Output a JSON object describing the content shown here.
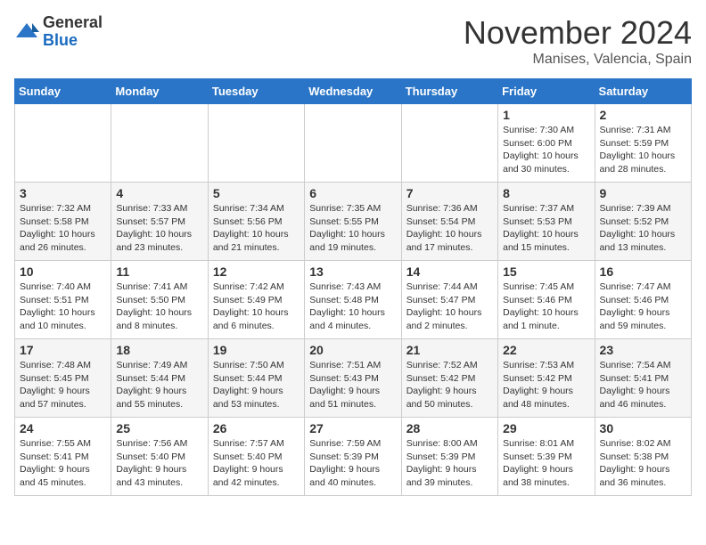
{
  "header": {
    "logo_general": "General",
    "logo_blue": "Blue",
    "month_title": "November 2024",
    "location": "Manises, Valencia, Spain"
  },
  "weekdays": [
    "Sunday",
    "Monday",
    "Tuesday",
    "Wednesday",
    "Thursday",
    "Friday",
    "Saturday"
  ],
  "weeks": [
    [
      {
        "day": "",
        "info": ""
      },
      {
        "day": "",
        "info": ""
      },
      {
        "day": "",
        "info": ""
      },
      {
        "day": "",
        "info": ""
      },
      {
        "day": "",
        "info": ""
      },
      {
        "day": "1",
        "info": "Sunrise: 7:30 AM\nSunset: 6:00 PM\nDaylight: 10 hours and 30 minutes."
      },
      {
        "day": "2",
        "info": "Sunrise: 7:31 AM\nSunset: 5:59 PM\nDaylight: 10 hours and 28 minutes."
      }
    ],
    [
      {
        "day": "3",
        "info": "Sunrise: 7:32 AM\nSunset: 5:58 PM\nDaylight: 10 hours and 26 minutes."
      },
      {
        "day": "4",
        "info": "Sunrise: 7:33 AM\nSunset: 5:57 PM\nDaylight: 10 hours and 23 minutes."
      },
      {
        "day": "5",
        "info": "Sunrise: 7:34 AM\nSunset: 5:56 PM\nDaylight: 10 hours and 21 minutes."
      },
      {
        "day": "6",
        "info": "Sunrise: 7:35 AM\nSunset: 5:55 PM\nDaylight: 10 hours and 19 minutes."
      },
      {
        "day": "7",
        "info": "Sunrise: 7:36 AM\nSunset: 5:54 PM\nDaylight: 10 hours and 17 minutes."
      },
      {
        "day": "8",
        "info": "Sunrise: 7:37 AM\nSunset: 5:53 PM\nDaylight: 10 hours and 15 minutes."
      },
      {
        "day": "9",
        "info": "Sunrise: 7:39 AM\nSunset: 5:52 PM\nDaylight: 10 hours and 13 minutes."
      }
    ],
    [
      {
        "day": "10",
        "info": "Sunrise: 7:40 AM\nSunset: 5:51 PM\nDaylight: 10 hours and 10 minutes."
      },
      {
        "day": "11",
        "info": "Sunrise: 7:41 AM\nSunset: 5:50 PM\nDaylight: 10 hours and 8 minutes."
      },
      {
        "day": "12",
        "info": "Sunrise: 7:42 AM\nSunset: 5:49 PM\nDaylight: 10 hours and 6 minutes."
      },
      {
        "day": "13",
        "info": "Sunrise: 7:43 AM\nSunset: 5:48 PM\nDaylight: 10 hours and 4 minutes."
      },
      {
        "day": "14",
        "info": "Sunrise: 7:44 AM\nSunset: 5:47 PM\nDaylight: 10 hours and 2 minutes."
      },
      {
        "day": "15",
        "info": "Sunrise: 7:45 AM\nSunset: 5:46 PM\nDaylight: 10 hours and 1 minute."
      },
      {
        "day": "16",
        "info": "Sunrise: 7:47 AM\nSunset: 5:46 PM\nDaylight: 9 hours and 59 minutes."
      }
    ],
    [
      {
        "day": "17",
        "info": "Sunrise: 7:48 AM\nSunset: 5:45 PM\nDaylight: 9 hours and 57 minutes."
      },
      {
        "day": "18",
        "info": "Sunrise: 7:49 AM\nSunset: 5:44 PM\nDaylight: 9 hours and 55 minutes."
      },
      {
        "day": "19",
        "info": "Sunrise: 7:50 AM\nSunset: 5:44 PM\nDaylight: 9 hours and 53 minutes."
      },
      {
        "day": "20",
        "info": "Sunrise: 7:51 AM\nSunset: 5:43 PM\nDaylight: 9 hours and 51 minutes."
      },
      {
        "day": "21",
        "info": "Sunrise: 7:52 AM\nSunset: 5:42 PM\nDaylight: 9 hours and 50 minutes."
      },
      {
        "day": "22",
        "info": "Sunrise: 7:53 AM\nSunset: 5:42 PM\nDaylight: 9 hours and 48 minutes."
      },
      {
        "day": "23",
        "info": "Sunrise: 7:54 AM\nSunset: 5:41 PM\nDaylight: 9 hours and 46 minutes."
      }
    ],
    [
      {
        "day": "24",
        "info": "Sunrise: 7:55 AM\nSunset: 5:41 PM\nDaylight: 9 hours and 45 minutes."
      },
      {
        "day": "25",
        "info": "Sunrise: 7:56 AM\nSunset: 5:40 PM\nDaylight: 9 hours and 43 minutes."
      },
      {
        "day": "26",
        "info": "Sunrise: 7:57 AM\nSunset: 5:40 PM\nDaylight: 9 hours and 42 minutes."
      },
      {
        "day": "27",
        "info": "Sunrise: 7:59 AM\nSunset: 5:39 PM\nDaylight: 9 hours and 40 minutes."
      },
      {
        "day": "28",
        "info": "Sunrise: 8:00 AM\nSunset: 5:39 PM\nDaylight: 9 hours and 39 minutes."
      },
      {
        "day": "29",
        "info": "Sunrise: 8:01 AM\nSunset: 5:39 PM\nDaylight: 9 hours and 38 minutes."
      },
      {
        "day": "30",
        "info": "Sunrise: 8:02 AM\nSunset: 5:38 PM\nDaylight: 9 hours and 36 minutes."
      }
    ]
  ]
}
